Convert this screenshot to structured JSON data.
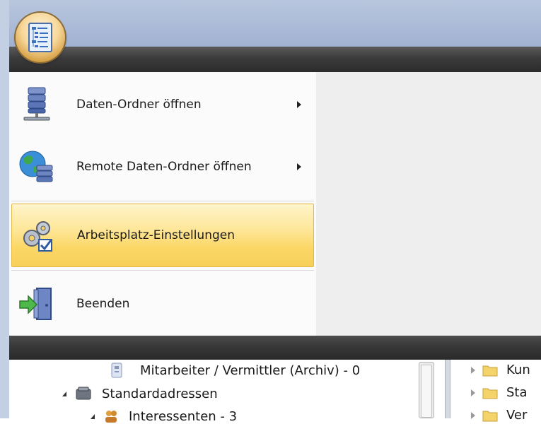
{
  "menu": {
    "items": [
      {
        "label": "Daten-Ordner öffnen",
        "icon": "database-server-icon",
        "has_submenu": true
      },
      {
        "label": "Remote Daten-Ordner öffnen",
        "icon": "globe-database-icon",
        "has_submenu": true
      },
      {
        "label": "Arbeitsplatz-Einstellungen",
        "icon": "gears-checkmark-icon",
        "highlighted": true
      },
      {
        "label": "Beenden",
        "icon": "exit-door-icon"
      }
    ]
  },
  "tree": {
    "rows": [
      {
        "label": "Mitarbeiter / Vermittler (Archiv) - 0"
      },
      {
        "label": "Standardadressen"
      },
      {
        "label": "Interessenten - 3"
      }
    ]
  },
  "right_tree": {
    "rows": [
      {
        "label": "Kun"
      },
      {
        "label": "Sta"
      },
      {
        "label": "Ver"
      }
    ]
  },
  "colors": {
    "highlight": "#fbd766",
    "menu_bar": "#333333",
    "title_bar": "#aab9d6"
  }
}
